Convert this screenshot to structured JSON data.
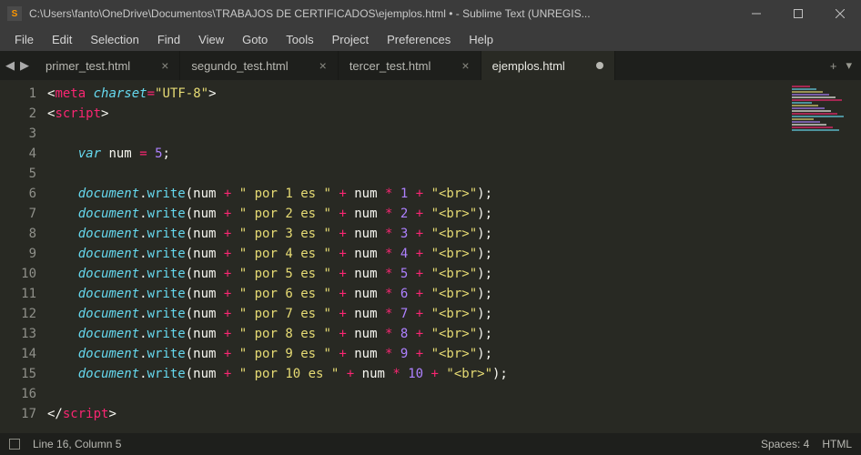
{
  "window": {
    "title": "C:\\Users\\fanto\\OneDrive\\Documentos\\TRABAJOS DE CERTIFICADOS\\ejemplos.html • - Sublime Text (UNREGIS...",
    "app_icon_letter": "S"
  },
  "menu": {
    "items": [
      "File",
      "Edit",
      "Selection",
      "Find",
      "View",
      "Goto",
      "Tools",
      "Project",
      "Preferences",
      "Help"
    ]
  },
  "tabs": {
    "arrow_left": "◀",
    "arrow_right": "▶",
    "items": [
      {
        "label": "primer_test.html",
        "active": false,
        "dirty": false
      },
      {
        "label": "segundo_test.html",
        "active": false,
        "dirty": false
      },
      {
        "label": "tercer_test.html",
        "active": false,
        "dirty": false
      },
      {
        "label": "ejemplos.html",
        "active": true,
        "dirty": true
      }
    ],
    "plus": "+",
    "dropdown": "▾"
  },
  "editor": {
    "line_start": 1,
    "line_end": 17,
    "lines": [
      {
        "n": 1,
        "html": "<span class='tok-br'>&lt;</span><span class='tok-tag'>meta</span> <span class='tok-key'>charset</span><span class='tok-op'>=</span><span class='tok-str'>\"UTF-8\"</span><span class='tok-br'>&gt;</span>"
      },
      {
        "n": 2,
        "html": "<span class='tok-br'>&lt;</span><span class='tok-tag'>script</span><span class='tok-br'>&gt;</span>"
      },
      {
        "n": 3,
        "html": ""
      },
      {
        "n": 4,
        "html": "    <span class='tok-key'>var</span> <span class='tok-br'>num</span> <span class='tok-op'>=</span> <span class='tok-num'>5</span><span class='tok-br'>;</span>"
      },
      {
        "n": 5,
        "html": ""
      },
      {
        "n": 6,
        "html": "    <span class='tok-doc'>document</span><span class='tok-br'>.</span><span class='tok-fn'>write</span><span class='tok-br'>(num </span><span class='tok-op'>+</span><span class='tok-str'> \" por 1 es \" </span><span class='tok-op'>+</span><span class='tok-br'> num </span><span class='tok-op'>*</span> <span class='tok-num'>1</span> <span class='tok-op'>+</span> <span class='tok-str'>\"&lt;br&gt;\"</span><span class='tok-br'>);</span>"
      },
      {
        "n": 7,
        "html": "    <span class='tok-doc'>document</span><span class='tok-br'>.</span><span class='tok-fn'>write</span><span class='tok-br'>(num </span><span class='tok-op'>+</span><span class='tok-str'> \" por 2 es \" </span><span class='tok-op'>+</span><span class='tok-br'> num </span><span class='tok-op'>*</span> <span class='tok-num'>2</span> <span class='tok-op'>+</span> <span class='tok-str'>\"&lt;br&gt;\"</span><span class='tok-br'>);</span>"
      },
      {
        "n": 8,
        "html": "    <span class='tok-doc'>document</span><span class='tok-br'>.</span><span class='tok-fn'>write</span><span class='tok-br'>(num </span><span class='tok-op'>+</span><span class='tok-str'> \" por 3 es \" </span><span class='tok-op'>+</span><span class='tok-br'> num </span><span class='tok-op'>*</span> <span class='tok-num'>3</span> <span class='tok-op'>+</span> <span class='tok-str'>\"&lt;br&gt;\"</span><span class='tok-br'>);</span>"
      },
      {
        "n": 9,
        "html": "    <span class='tok-doc'>document</span><span class='tok-br'>.</span><span class='tok-fn'>write</span><span class='tok-br'>(num </span><span class='tok-op'>+</span><span class='tok-str'> \" por 4 es \" </span><span class='tok-op'>+</span><span class='tok-br'> num </span><span class='tok-op'>*</span> <span class='tok-num'>4</span> <span class='tok-op'>+</span> <span class='tok-str'>\"&lt;br&gt;\"</span><span class='tok-br'>);</span>"
      },
      {
        "n": 10,
        "html": "    <span class='tok-doc'>document</span><span class='tok-br'>.</span><span class='tok-fn'>write</span><span class='tok-br'>(num </span><span class='tok-op'>+</span><span class='tok-str'> \" por 5 es \" </span><span class='tok-op'>+</span><span class='tok-br'> num </span><span class='tok-op'>*</span> <span class='tok-num'>5</span> <span class='tok-op'>+</span> <span class='tok-str'>\"&lt;br&gt;\"</span><span class='tok-br'>);</span>"
      },
      {
        "n": 11,
        "html": "    <span class='tok-doc'>document</span><span class='tok-br'>.</span><span class='tok-fn'>write</span><span class='tok-br'>(num </span><span class='tok-op'>+</span><span class='tok-str'> \" por 6 es \" </span><span class='tok-op'>+</span><span class='tok-br'> num </span><span class='tok-op'>*</span> <span class='tok-num'>6</span> <span class='tok-op'>+</span> <span class='tok-str'>\"&lt;br&gt;\"</span><span class='tok-br'>);</span>"
      },
      {
        "n": 12,
        "html": "    <span class='tok-doc'>document</span><span class='tok-br'>.</span><span class='tok-fn'>write</span><span class='tok-br'>(num </span><span class='tok-op'>+</span><span class='tok-str'> \" por 7 es \" </span><span class='tok-op'>+</span><span class='tok-br'> num </span><span class='tok-op'>*</span> <span class='tok-num'>7</span> <span class='tok-op'>+</span> <span class='tok-str'>\"&lt;br&gt;\"</span><span class='tok-br'>);</span>"
      },
      {
        "n": 13,
        "html": "    <span class='tok-doc'>document</span><span class='tok-br'>.</span><span class='tok-fn'>write</span><span class='tok-br'>(num </span><span class='tok-op'>+</span><span class='tok-str'> \" por 8 es \" </span><span class='tok-op'>+</span><span class='tok-br'> num </span><span class='tok-op'>*</span> <span class='tok-num'>8</span> <span class='tok-op'>+</span> <span class='tok-str'>\"&lt;br&gt;\"</span><span class='tok-br'>);</span>"
      },
      {
        "n": 14,
        "html": "    <span class='tok-doc'>document</span><span class='tok-br'>.</span><span class='tok-fn'>write</span><span class='tok-br'>(num </span><span class='tok-op'>+</span><span class='tok-str'> \" por 9 es \" </span><span class='tok-op'>+</span><span class='tok-br'> num </span><span class='tok-op'>*</span> <span class='tok-num'>9</span> <span class='tok-op'>+</span> <span class='tok-str'>\"&lt;br&gt;\"</span><span class='tok-br'>);</span>"
      },
      {
        "n": 15,
        "html": "    <span class='tok-doc'>document</span><span class='tok-br'>.</span><span class='tok-fn'>write</span><span class='tok-br'>(num </span><span class='tok-op'>+</span><span class='tok-str'> \" por 10 es \" </span><span class='tok-op'>+</span><span class='tok-br'> num </span><span class='tok-op'>*</span> <span class='tok-num'>10</span> <span class='tok-op'>+</span> <span class='tok-str'>\"&lt;br&gt;\"</span><span class='tok-br'>);</span>"
      },
      {
        "n": 16,
        "html": ""
      },
      {
        "n": 17,
        "html": "<span class='tok-br'>&lt;/</span><span class='tok-tag'>script</span><span class='tok-br'>&gt;</span>"
      }
    ]
  },
  "status": {
    "cursor": "Line 16, Column 5",
    "spaces": "Spaces: 4",
    "syntax": "HTML"
  }
}
